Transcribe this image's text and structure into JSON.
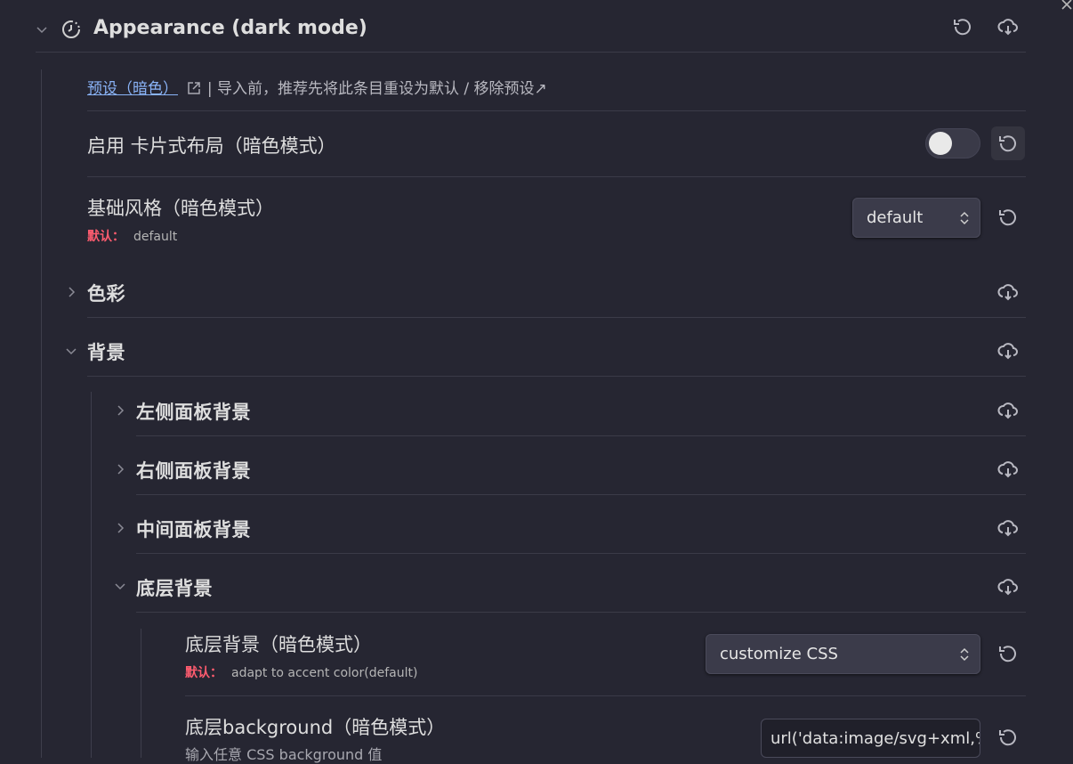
{
  "header": {
    "title": "Appearance (dark mode)"
  },
  "presets": {
    "link_label": "预设（暗色）",
    "description": "| 导入前，推荐先将此条目重设为默认 / 移除预设↗"
  },
  "settings": {
    "card_layout": {
      "label": "启用 卡片式布局（暗色模式）",
      "enabled": false
    },
    "base_style": {
      "label": "基础风格（暗色模式）",
      "default_label": "默认：",
      "default_value": "default",
      "selected": "default"
    },
    "bottom_bg": {
      "label": "底层背景（暗色模式）",
      "default_label": "默认：",
      "default_value": "adapt to accent color(default)",
      "selected": "customize CSS"
    },
    "bottom_bg_css": {
      "label": "底层background（暗色模式）",
      "description": "输入任意 CSS background 值",
      "value": "url('data:image/svg+xml,%"
    }
  },
  "sections": {
    "color": "色彩",
    "background": "背景",
    "left_panel_bg": "左侧面板背景",
    "right_panel_bg": "右侧面板背景",
    "middle_panel_bg": "中间面板背景",
    "bottom_bg": "底层背景"
  },
  "icons": {
    "reset": "rotate-ccw-icon",
    "import": "cloud-download-icon",
    "theme": "moon-clock-icon",
    "external": "external-link-icon"
  }
}
